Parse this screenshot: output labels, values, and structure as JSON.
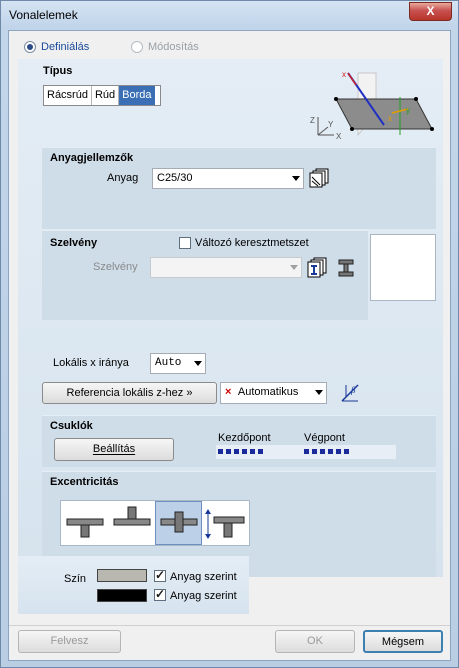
{
  "window": {
    "title": "Vonalelemek",
    "close_label": "X"
  },
  "mode": {
    "define_label": "Definiálás",
    "modify_label": "Módosítás"
  },
  "type": {
    "title": "Típus",
    "options": [
      "Rácsrúd",
      "Rúd",
      "Borda"
    ],
    "active": "Borda",
    "axis_labels": {
      "z": "Z",
      "y": "Y",
      "x": "X",
      "red_x": "x",
      "g_y": "y",
      "g_x": "x"
    }
  },
  "material": {
    "title": "Anyagjellemzők",
    "label": "Anyag",
    "value": "C25/30"
  },
  "section": {
    "title": "Szelvény",
    "variable_label": "Változó keresztmetszet",
    "field_label": "Szelvény",
    "field_value": ""
  },
  "local_x": {
    "label": "Lokális x iránya",
    "value": "Auto"
  },
  "ref_z": {
    "button_label": "Referencia lokális z-hez »",
    "value": "Automatikus",
    "marker": "×"
  },
  "hinges": {
    "title": "Csuklók",
    "settings_label": "Beállítás",
    "start_label": "Kezdőpont",
    "end_label": "Végpont"
  },
  "eccentricity": {
    "title": "Excentricitás",
    "active_index": 2
  },
  "color": {
    "label": "Szín",
    "swatch1": "#b8b8b0",
    "swatch2": "#000000",
    "by_material_1": "Anyag szerint",
    "by_material_2": "Anyag szerint"
  },
  "footer": {
    "add_label": "Felvesz",
    "ok_label": "OK",
    "cancel_label": "Mégsem"
  },
  "colors": {
    "accent": "#3a6fb5",
    "hinge_dots": "#1a2a9a",
    "marker_red": "#cc0000"
  }
}
